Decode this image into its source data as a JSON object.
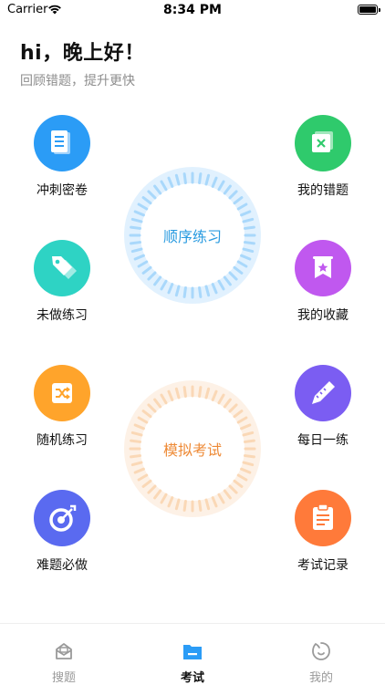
{
  "status_bar": {
    "carrier": "Carrier",
    "time": "8:34 PM"
  },
  "header": {
    "greeting": "hi，晚上好！",
    "subtitle": "回顾错题，提升更快"
  },
  "features_left": [
    {
      "label": "冲刺密卷",
      "icon": "exam-paper-icon",
      "color": "#2b9cf6"
    },
    {
      "label": "未做练习",
      "icon": "tag-icon",
      "color": "#2ed3c4"
    },
    {
      "label": "随机练习",
      "icon": "shuffle-icon",
      "color": "#ffa42b"
    },
    {
      "label": "难题必做",
      "icon": "target-icon",
      "color": "#5a6af0"
    }
  ],
  "features_right": [
    {
      "label": "我的错题",
      "icon": "wrong-answer-icon",
      "color": "#2fca6c"
    },
    {
      "label": "我的收藏",
      "icon": "bookmark-star-icon",
      "color": "#c058ef"
    },
    {
      "label": "每日一练",
      "icon": "pencil-icon",
      "color": "#7b5df2"
    },
    {
      "label": "考试记录",
      "icon": "clipboard-icon",
      "color": "#ff7a3a"
    }
  ],
  "rings": {
    "sequential": {
      "label": "顺序练习",
      "color": "#2a9be0",
      "tick_color": "#a9d8fb"
    },
    "mock_exam": {
      "label": "模拟考试",
      "color": "#ee8a36",
      "tick_color": "#fad8b6"
    }
  },
  "tabbar": {
    "tabs": [
      {
        "label": "搜题",
        "icon": "search-question-icon",
        "active": false
      },
      {
        "label": "考试",
        "icon": "exam-folder-icon",
        "active": true
      },
      {
        "label": "我的",
        "icon": "profile-icon",
        "active": false
      }
    ],
    "active_color": "#2b9cf6",
    "inactive_color": "#9a9a9a"
  }
}
